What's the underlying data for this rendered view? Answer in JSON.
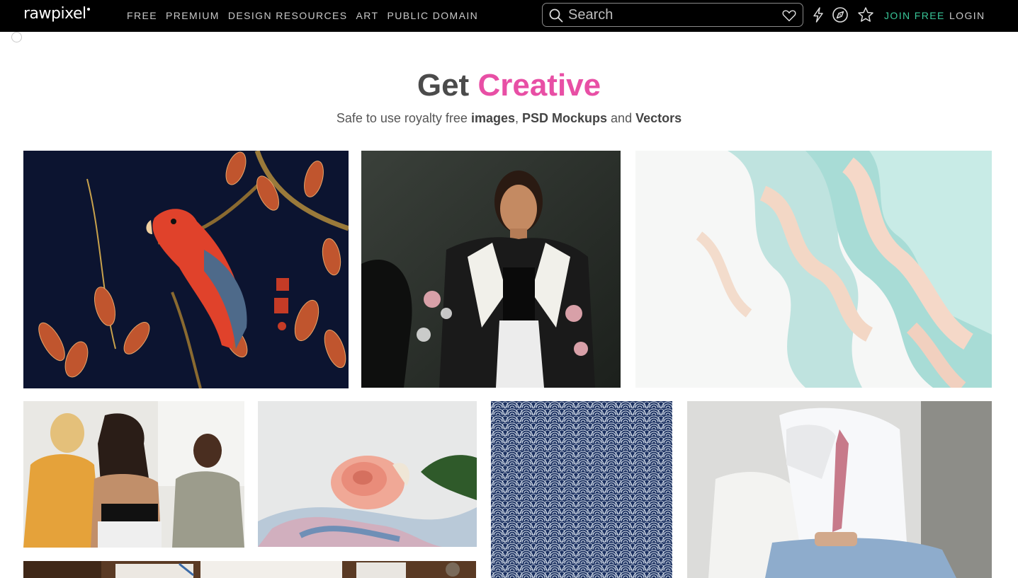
{
  "header": {
    "logo": "rawpixel",
    "nav": [
      "FREE",
      "PREMIUM",
      "DESIGN RESOURCES",
      "ART",
      "PUBLIC DOMAIN"
    ],
    "search_placeholder": "Search",
    "join_label": "JOIN FREE",
    "login_label": "LOGIN",
    "icons": [
      "bolt-icon",
      "compass-icon",
      "star-icon",
      "heart-icon",
      "search-icon"
    ]
  },
  "hero": {
    "title_prefix": "Get",
    "title_accent": "Creative",
    "subtitle_1": "Safe to use royalty free ",
    "subtitle_images": "images",
    "subtitle_2": ", ",
    "subtitle_psd": "PSD Mockups",
    "subtitle_3": " and ",
    "subtitle_vectors": "Vectors"
  },
  "colors": {
    "accent": "#e84fa5",
    "join": "#39c698",
    "topbar": "#000000"
  },
  "gallery": {
    "images": [
      "parrot-artwork",
      "fashion-model-photo",
      "marble-texture",
      "friends-hair-photo",
      "rose-on-fabric-photo",
      "wave-pattern",
      "businessman-photo",
      "desk-workspace-photo"
    ]
  }
}
